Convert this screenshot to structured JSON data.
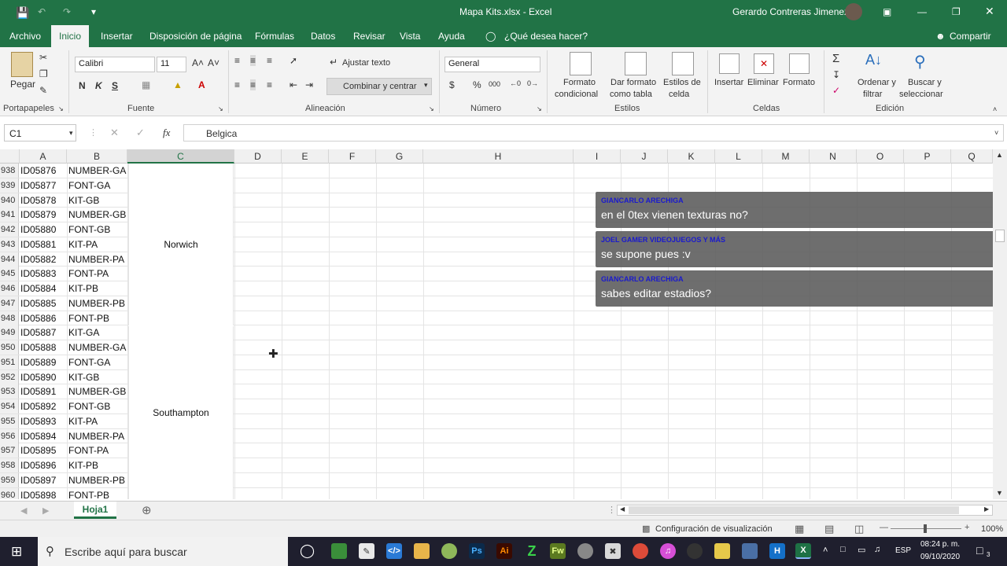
{
  "window": {
    "title": "Mapa Kits.xlsx  -  Excel",
    "user": "Gerardo Contreras Jimenez"
  },
  "menu": {
    "tabs": [
      "Archivo",
      "Inicio",
      "Insertar",
      "Disposición de página",
      "Fórmulas",
      "Datos",
      "Revisar",
      "Vista",
      "Ayuda"
    ],
    "tell_me": "¿Qué desea hacer?",
    "share": "Compartir"
  },
  "ribbon": {
    "paste": "Pegar",
    "font_name": "Calibri",
    "font_size": "11",
    "bold": "N",
    "italic": "K",
    "underline": "S",
    "wrap_text": "Ajustar texto",
    "merge_center": "Combinar y centrar",
    "number_format": "General",
    "currency": "$",
    "percent": "%",
    "thousands": "000",
    "cond_format_1": "Formato",
    "cond_format_2": "condicional",
    "table_format_1": "Dar formato",
    "table_format_2": "como tabla",
    "cell_styles_1": "Estilos de",
    "cell_styles_2": "celda",
    "insert": "Insertar",
    "delete": "Eliminar",
    "format": "Formato",
    "sort_1": "Ordenar y",
    "sort_2": "filtrar",
    "find_1": "Buscar y",
    "find_2": "seleccionar",
    "groups": {
      "clipboard": "Portapapeles",
      "font": "Fuente",
      "alignment": "Alineación",
      "number": "Número",
      "styles": "Estilos",
      "cells": "Celdas",
      "editing": "Edición"
    }
  },
  "formula_bar": {
    "name_box": "C1",
    "fx": "fx",
    "content": "Belgica"
  },
  "columns": [
    "A",
    "B",
    "C",
    "D",
    "E",
    "F",
    "G",
    "H",
    "I",
    "J",
    "K",
    "L",
    "M",
    "N",
    "O",
    "P",
    "Q"
  ],
  "rows": [
    {
      "n": "938",
      "a": "ID05876",
      "b": "NUMBER-GA"
    },
    {
      "n": "939",
      "a": "ID05877",
      "b": "FONT-GA"
    },
    {
      "n": "940",
      "a": "ID05878",
      "b": "KIT-GB"
    },
    {
      "n": "941",
      "a": "ID05879",
      "b": "NUMBER-GB"
    },
    {
      "n": "942",
      "a": "ID05880",
      "b": "FONT-GB"
    },
    {
      "n": "943",
      "a": "ID05881",
      "b": "KIT-PA"
    },
    {
      "n": "944",
      "a": "ID05882",
      "b": "NUMBER-PA"
    },
    {
      "n": "945",
      "a": "ID05883",
      "b": "FONT-PA"
    },
    {
      "n": "946",
      "a": "ID05884",
      "b": "KIT-PB"
    },
    {
      "n": "947",
      "a": "ID05885",
      "b": "NUMBER-PB"
    },
    {
      "n": "948",
      "a": "ID05886",
      "b": "FONT-PB"
    },
    {
      "n": "949",
      "a": "ID05887",
      "b": "KIT-GA"
    },
    {
      "n": "950",
      "a": "ID05888",
      "b": "NUMBER-GA"
    },
    {
      "n": "951",
      "a": "ID05889",
      "b": "FONT-GA"
    },
    {
      "n": "952",
      "a": "ID05890",
      "b": "KIT-GB"
    },
    {
      "n": "953",
      "a": "ID05891",
      "b": "NUMBER-GB"
    },
    {
      "n": "954",
      "a": "ID05892",
      "b": "FONT-GB"
    },
    {
      "n": "955",
      "a": "ID05893",
      "b": "KIT-PA"
    },
    {
      "n": "956",
      "a": "ID05894",
      "b": "NUMBER-PA"
    },
    {
      "n": "957",
      "a": "ID05895",
      "b": "FONT-PA"
    },
    {
      "n": "958",
      "a": "ID05896",
      "b": "KIT-PB"
    },
    {
      "n": "959",
      "a": "ID05897",
      "b": "NUMBER-PB"
    },
    {
      "n": "960",
      "a": "ID05898",
      "b": "FONT-PB"
    }
  ],
  "merged": [
    "Norwich",
    "Southampton"
  ],
  "chat": [
    {
      "user": "GIANCARLO ARECHIGA",
      "msg": "en el 0tex vienen texturas no?"
    },
    {
      "user": "JOEL GAMER VIDEOJUEGOS Y MÁS",
      "msg": "se supone pues :v"
    },
    {
      "user": "GIANCARLO ARECHIGA",
      "msg": "sabes editar estadios?"
    }
  ],
  "sheet_tab": "Hoja1",
  "status": {
    "display_settings": "Configuración de visualización",
    "zoom": "100%"
  },
  "taskbar": {
    "search": "Escribe aquí para buscar",
    "lang": "ESP",
    "time": "08:24 p. m.",
    "date": "09/10/2020",
    "notif": "3"
  },
  "colors": {
    "excel_green": "#217346",
    "chat_user": "#1a1acd"
  }
}
